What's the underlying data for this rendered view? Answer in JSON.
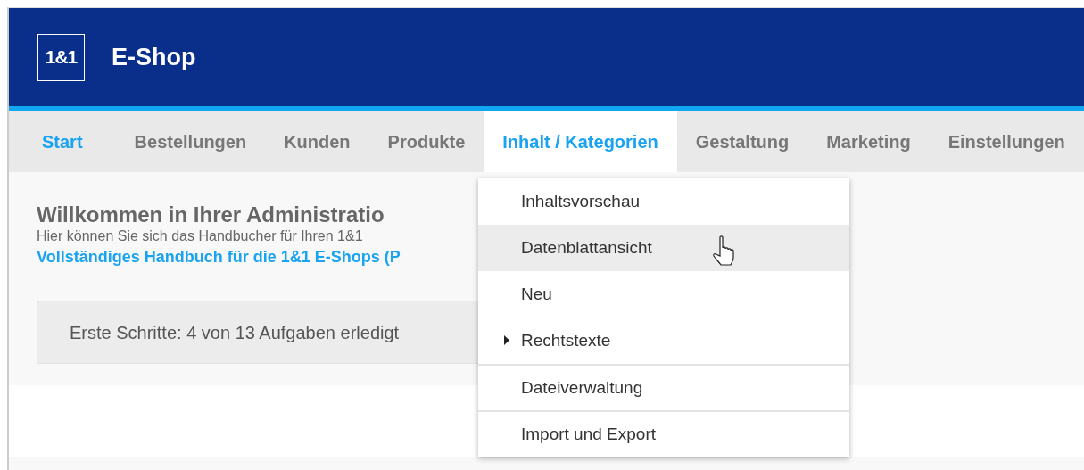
{
  "header": {
    "logo": "1&1",
    "title": "E-Shop"
  },
  "nav": [
    {
      "label": "Start",
      "selected": true,
      "expanded": false
    },
    {
      "label": "Bestellungen",
      "selected": false,
      "expanded": false
    },
    {
      "label": "Kunden",
      "selected": false,
      "expanded": false
    },
    {
      "label": "Produkte",
      "selected": false,
      "expanded": false
    },
    {
      "label": "Inhalt / Kategorien",
      "selected": false,
      "expanded": true
    },
    {
      "label": "Gestaltung",
      "selected": false,
      "expanded": false
    },
    {
      "label": "Marketing",
      "selected": false,
      "expanded": false
    },
    {
      "label": "Einstellungen",
      "selected": false,
      "expanded": false
    }
  ],
  "welcome": {
    "title": "Willkommen in Ihrer Administratio",
    "text": "Hier können Sie sich das Handbucher für Ihren 1&1",
    "link": "Vollständiges Handbuch für die 1&1 E-Shops (P"
  },
  "progress": {
    "text": "Erste Schritte: 4 von 13 Aufgaben erledigt"
  },
  "dropdown": [
    {
      "label": "Inhaltsvorschau",
      "kind": "item",
      "highlighted": false,
      "divider_before": false
    },
    {
      "label": "Datenblattansicht",
      "kind": "item",
      "highlighted": true,
      "divider_before": false
    },
    {
      "label": "Neu",
      "kind": "item",
      "highlighted": false,
      "divider_before": false
    },
    {
      "label": "Rechtstexte",
      "kind": "submenu",
      "highlighted": false,
      "divider_before": false
    },
    {
      "label": "Dateiverwaltung",
      "kind": "item",
      "highlighted": false,
      "divider_before": true
    },
    {
      "label": "Import und Export",
      "kind": "item",
      "highlighted": false,
      "divider_before": true
    }
  ]
}
